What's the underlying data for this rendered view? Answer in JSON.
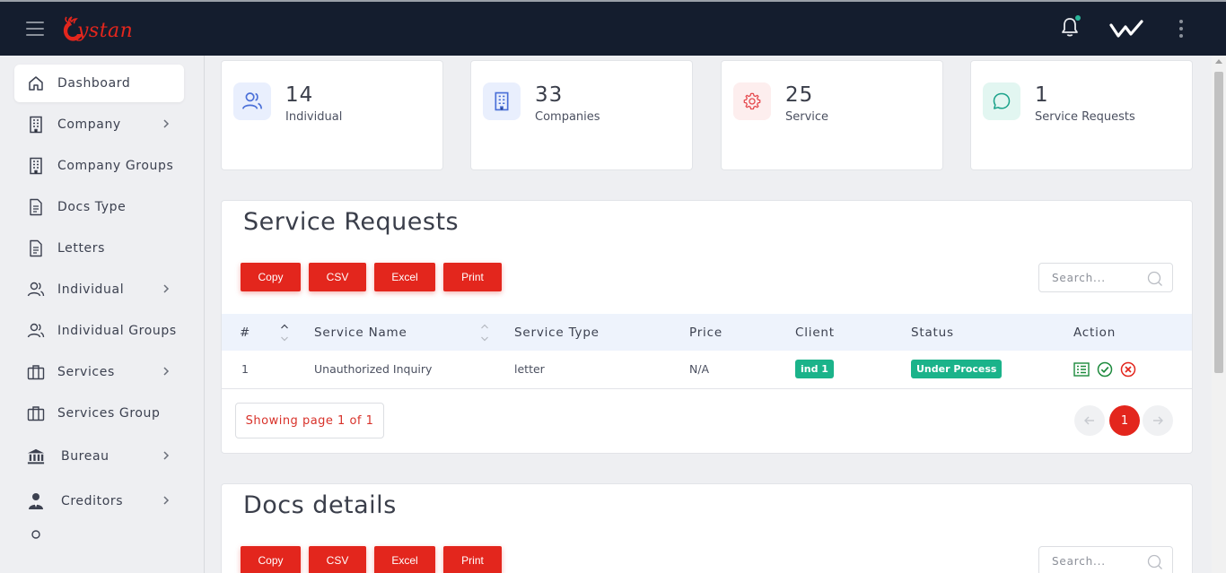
{
  "brand": {
    "name": "ystan",
    "accent": "#e3261d"
  },
  "topbar": {
    "bg": "#141d2e",
    "notification_dot_color": "#2bb59a"
  },
  "sidebar": {
    "items": [
      {
        "label": "Dashboard",
        "icon": "home-icon",
        "active": true,
        "has_children": false
      },
      {
        "label": "Company",
        "icon": "building-icon",
        "active": false,
        "has_children": true
      },
      {
        "label": "Company Groups",
        "icon": "building-icon",
        "active": false,
        "has_children": false
      },
      {
        "label": "Docs Type",
        "icon": "document-icon",
        "active": false,
        "has_children": false
      },
      {
        "label": "Letters",
        "icon": "document-icon",
        "active": false,
        "has_children": false
      },
      {
        "label": "Individual",
        "icon": "users-icon",
        "active": false,
        "has_children": true
      },
      {
        "label": "Individual Groups",
        "icon": "users-icon",
        "active": false,
        "has_children": false
      },
      {
        "label": "Services",
        "icon": "briefcase-icon",
        "active": false,
        "has_children": true
      },
      {
        "label": "Services Group",
        "icon": "briefcase-icon",
        "active": false,
        "has_children": false
      },
      {
        "label": "Bureau",
        "icon": "bank-icon",
        "active": false,
        "has_children": true
      },
      {
        "label": "Creditors",
        "icon": "person-icon",
        "active": false,
        "has_children": true
      }
    ]
  },
  "stats": [
    {
      "value": "14",
      "label": "Individual",
      "icon": "users-icon",
      "color": "#4a6fd8",
      "bg": "#e9effd"
    },
    {
      "value": "33",
      "label": "Companies",
      "icon": "building-icon",
      "color": "#4a6fd8",
      "bg": "#e9effd"
    },
    {
      "value": "25",
      "label": "Service",
      "icon": "gear-icon",
      "color": "#e5484d",
      "bg": "#fdeeee"
    },
    {
      "value": "1",
      "label": "Service Requests",
      "icon": "chat-icon",
      "color": "#1aa28a",
      "bg": "#e2f6f1"
    }
  ],
  "service_requests": {
    "title": "Service Requests",
    "buttons": [
      "Copy",
      "CSV",
      "Excel",
      "Print"
    ],
    "search_placeholder": "Search...",
    "columns": [
      "#",
      "Service Name",
      "Service Type",
      "Price",
      "Client",
      "Status",
      "Action"
    ],
    "rows": [
      {
        "num": "1",
        "service_name": "Unauthorized Inquiry",
        "service_type": "letter",
        "price": "N/A",
        "client": "ind 1",
        "status": "Under Process"
      }
    ],
    "footer": {
      "showing": "Showing page 1 of 1",
      "current_page": "1"
    }
  },
  "docs_details": {
    "title": "Docs details",
    "buttons": [
      "Copy",
      "CSV",
      "Excel",
      "Print"
    ],
    "search_placeholder": "Search..."
  }
}
